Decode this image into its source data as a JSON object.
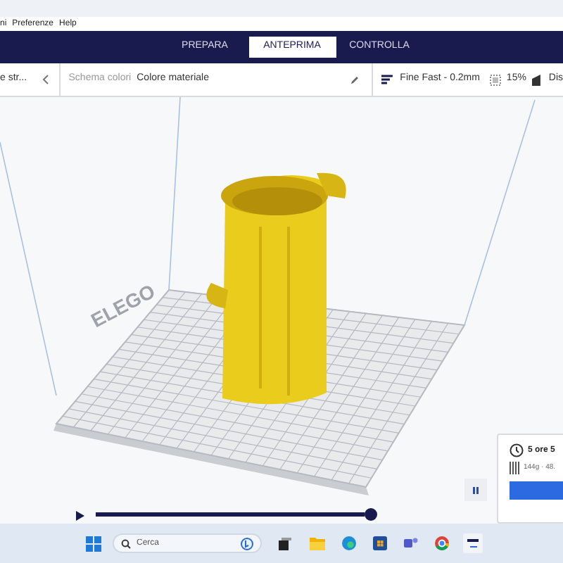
{
  "menu_bar": {
    "items": [
      "ni",
      "Preferenze",
      "Help"
    ]
  },
  "stage_tabs": [
    {
      "label": "PREPARA",
      "selected": false
    },
    {
      "label": "ANTEPRIMA",
      "selected": true
    },
    {
      "label": "CONTROLLA",
      "selected": false
    }
  ],
  "toolbar": {
    "view_type": "e str...",
    "color_scheme_label": "Schema colori",
    "color_scheme_value": "Colore materiale",
    "profile": "Fine Fast - 0.2mm",
    "infill": "15%",
    "support": "Dis"
  },
  "viewport": {
    "plate_logo": "ELEGO"
  },
  "playback": {
    "playing": false,
    "level": 1
  },
  "print_info": {
    "time": "5 ore 5",
    "material": "144g · 48."
  },
  "taskbar": {
    "search_placeholder": "Cerca"
  }
}
